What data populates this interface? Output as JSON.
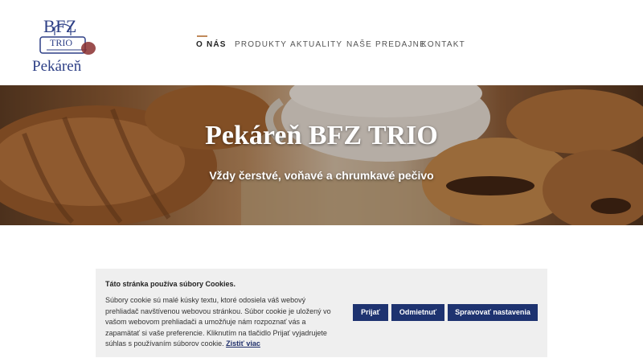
{
  "logo": {
    "line1": "BFZ",
    "line2": "TRIO",
    "line3": "Pekáreň"
  },
  "nav": {
    "items": [
      {
        "label": "O NÁS",
        "active": true
      },
      {
        "label": "PRODUKTY",
        "active": false
      },
      {
        "label": "AKTUALITY",
        "active": false
      },
      {
        "label": "NAŠE PREDAJNE",
        "active": false
      },
      {
        "label": "KONTAKT",
        "active": false
      }
    ]
  },
  "hero": {
    "title": "Pekáreň BFZ TRIO",
    "subtitle": "Vždy čerstvé, voňavé a chrumkavé pečivo"
  },
  "cookie": {
    "title": "Táto stránka používa súbory Cookies.",
    "text": "Súbory cookie sú malé kúsky textu, ktoré odosiela váš webový prehliadač navštívenou webovou stránkou. Súbor cookie je uložený vo vašom webovom prehliadači a umožňuje nám rozpoznať vás a zapamätať si vaše preferencie. Kliknutím na tlačidlo Prijať vyjadrujete súhlas s používaním súborov cookie.",
    "link": "Zistiť viac",
    "accept": "Prijať",
    "reject": "Odmietnuť",
    "manage": "Spravovať nastavenia"
  },
  "colors": {
    "brand_blue": "#2d3f86",
    "button_blue": "#1e3370",
    "accent": "#c08a5b",
    "banner_bg": "#efefef"
  }
}
